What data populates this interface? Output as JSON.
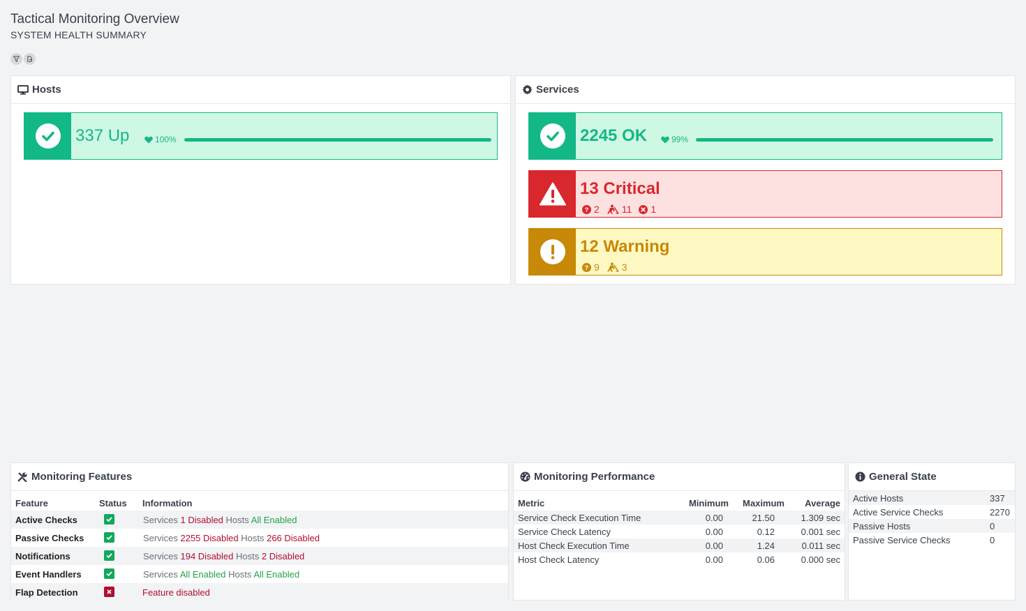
{
  "page": {
    "title": "Tactical Monitoring Overview",
    "subtitle": "SYSTEM HEALTH SUMMARY"
  },
  "colors": {
    "ok": "#13b887",
    "critical": "#d9272e",
    "warning": "#c88808",
    "disabled_red": "#b00e32",
    "enabled_green": "#1fa44a"
  },
  "hosts": {
    "header": "Hosts",
    "header_icon": "monitor-icon",
    "up": {
      "count_label": "337 Up",
      "health": "100%",
      "health_fraction": 1.0
    }
  },
  "services": {
    "header": "Services",
    "header_icon": "gear-icon",
    "ok": {
      "count_label": "2245 OK",
      "health": "99%",
      "health_fraction": 0.99
    },
    "critical": {
      "count_label": "13 Critical",
      "unknown": "2",
      "acknowledged": "11",
      "unhandled": "1"
    },
    "warning": {
      "count_label": "12 Warning",
      "unknown": "9",
      "acknowledged": "3"
    }
  },
  "features": {
    "header": "Monitoring Features",
    "columns": [
      "Feature",
      "Status",
      "Information"
    ],
    "rows": [
      {
        "name": "Active Checks",
        "enabled": true,
        "svc_label": "Services",
        "svc_value": "1 Disabled",
        "host_label": "Hosts",
        "host_value": "All Enabled"
      },
      {
        "name": "Passive Checks",
        "enabled": true,
        "svc_label": "Services",
        "svc_value": "2255 Disabled",
        "host_label": "Hosts",
        "host_value": "266 Disabled"
      },
      {
        "name": "Notifications",
        "enabled": true,
        "svc_label": "Services",
        "svc_value": "194 Disabled",
        "host_label": "Hosts",
        "host_value": "2 Disabled"
      },
      {
        "name": "Event Handlers",
        "enabled": true,
        "svc_label": "Services",
        "svc_value": "All Enabled",
        "host_label": "Hosts",
        "host_value": "All Enabled"
      },
      {
        "name": "Flap Detection",
        "enabled": false,
        "info": "Feature disabled"
      }
    ]
  },
  "performance": {
    "header": "Monitoring Performance",
    "columns": [
      "Metric",
      "Minimum",
      "Maximum",
      "Average"
    ],
    "rows": [
      {
        "metric": "Service Check Execution Time",
        "min": "0.00",
        "max": "21.50",
        "avg": "1.309 sec"
      },
      {
        "metric": "Service Check Latency",
        "min": "0.00",
        "max": "0.12",
        "avg": "0.001 sec"
      },
      {
        "metric": "Host Check Execution Time",
        "min": "0.00",
        "max": "1.24",
        "avg": "0.011 sec"
      },
      {
        "metric": "Host Check Latency",
        "min": "0.00",
        "max": "0.06",
        "avg": "0.000 sec"
      }
    ]
  },
  "general": {
    "header": "General State",
    "rows": [
      {
        "label": "Active Hosts",
        "value": "337"
      },
      {
        "label": "Active Service Checks",
        "value": "2270"
      },
      {
        "label": "Passive Hosts",
        "value": "0"
      },
      {
        "label": "Passive Service Checks",
        "value": "0"
      }
    ]
  }
}
